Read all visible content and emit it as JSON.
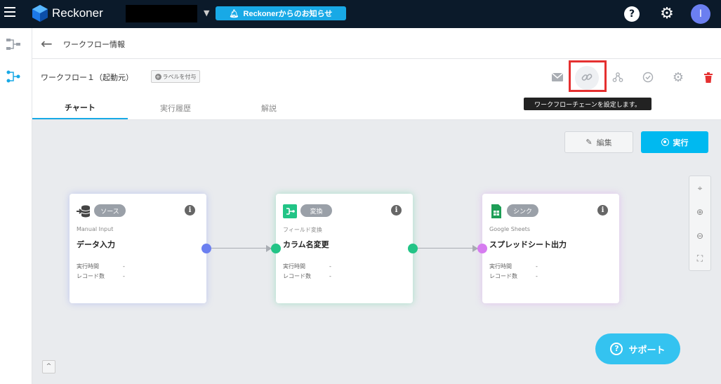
{
  "topbar": {
    "brand": "Reckoner",
    "notice_label": "Reckonerからのお知らせ",
    "help_symbol": "?",
    "avatar_initial": "I"
  },
  "header": {
    "back_symbol": "←",
    "page_title": "ワークフロー情報"
  },
  "workflow": {
    "name": "ワークフロー１（起動元）",
    "label_button": "ラベルを付与",
    "tooltip": "ワークフローチェーンを設定します。"
  },
  "tabs": [
    {
      "label": "チャート",
      "active": true
    },
    {
      "label": "実行履歴",
      "active": false
    },
    {
      "label": "解説",
      "active": false
    }
  ],
  "canvas": {
    "edit_label": "編集",
    "run_label": "実行",
    "support_label": "サポート",
    "support_symbol": "?",
    "collapse_symbol": "^"
  },
  "nodes": [
    {
      "badge": "ソース",
      "subtitle": "Manual Input",
      "title": "データ入力",
      "icon": "database-icon",
      "color": "#6b7ff0",
      "rows": [
        {
          "k": "実行時間",
          "v": "-"
        },
        {
          "k": "レコード数",
          "v": "-"
        }
      ]
    },
    {
      "badge": "変換",
      "subtitle": "フィールド変換",
      "title": "カラム名変更",
      "icon": "transform-icon",
      "color": "#22c486",
      "rows": [
        {
          "k": "実行時間",
          "v": "-"
        },
        {
          "k": "レコード数",
          "v": "-"
        }
      ]
    },
    {
      "badge": "シンク",
      "subtitle": "Google Sheets",
      "title": "スプレッドシート出力",
      "icon": "sheets-icon",
      "color": "#d67cf0",
      "rows": [
        {
          "k": "実行時間",
          "v": "-"
        },
        {
          "k": "レコード数",
          "v": "-"
        }
      ]
    }
  ],
  "info_symbol": "i",
  "colors": {
    "topbar": "#0b1a2a",
    "accent": "#18a9e6",
    "run": "#00b9f0",
    "delete": "#e53030"
  }
}
